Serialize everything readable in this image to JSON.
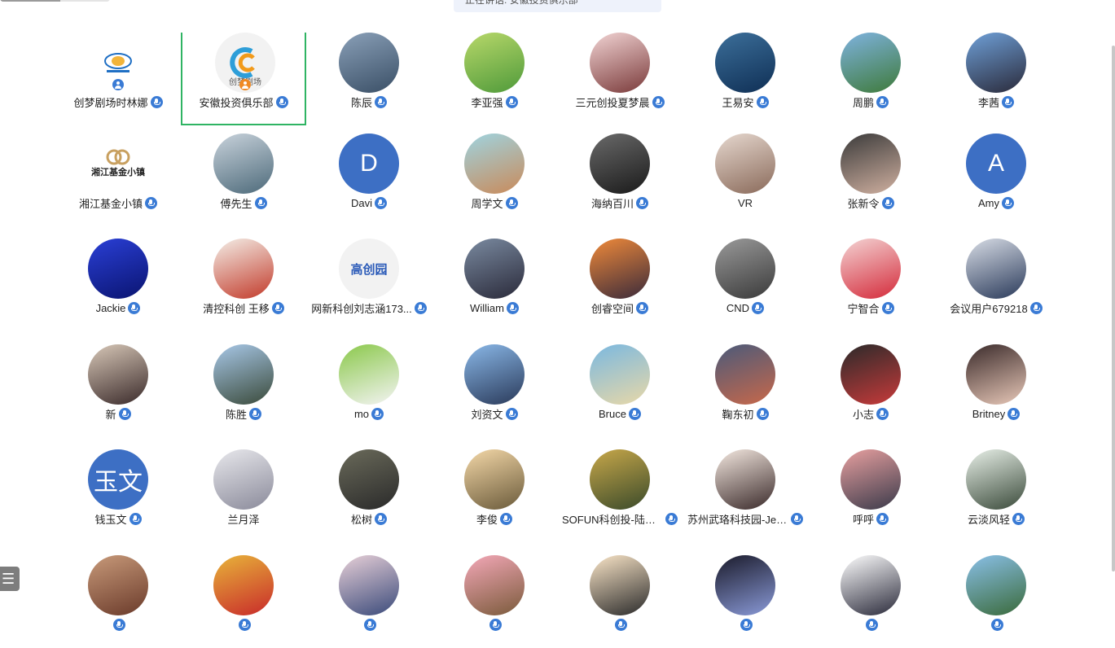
{
  "toast": {
    "text": "正在讲话: 安徽投资俱乐部"
  },
  "participants": [
    {
      "name": "创梦剧场时林娜",
      "mic": true,
      "badge": "blue",
      "avatar": "logo-blue"
    },
    {
      "name": "安徽投资俱乐部",
      "mic": true,
      "badge": "orange",
      "selected": true,
      "avatar": "logo-c",
      "logo_text": "创梦剧场"
    },
    {
      "name": "陈辰",
      "mic": true,
      "avatar": "photo",
      "colors": [
        "#8aa0b8",
        "#3a4f66"
      ]
    },
    {
      "name": "李亚强",
      "mic": true,
      "avatar": "photo",
      "colors": [
        "#b8d86a",
        "#4f9a3a"
      ]
    },
    {
      "name": "三元创投夏梦晨",
      "mic": true,
      "avatar": "photo",
      "colors": [
        "#f2d4d4",
        "#7a3a3a"
      ]
    },
    {
      "name": "王易安",
      "mic": true,
      "avatar": "photo",
      "colors": [
        "#3c6f9a",
        "#0f2f55"
      ]
    },
    {
      "name": "周鹏",
      "mic": true,
      "avatar": "photo",
      "colors": [
        "#7fb3e0",
        "#3e7a3a"
      ]
    },
    {
      "name": "李茜",
      "mic": true,
      "avatar": "photo",
      "colors": [
        "#6fa0d8",
        "#2a2a3a"
      ]
    },
    {
      "name": "湘江基金小镇",
      "mic": true,
      "avatar": "logo-xiang",
      "logo_text": "湘江基金小镇"
    },
    {
      "name": "傅先生",
      "mic": true,
      "avatar": "photo",
      "colors": [
        "#c9d3dc",
        "#4d6a7a"
      ]
    },
    {
      "name": "Davi",
      "mic": true,
      "avatar": "letter",
      "letter": "D"
    },
    {
      "name": "周学文",
      "mic": true,
      "avatar": "photo",
      "colors": [
        "#9fd4e0",
        "#c98a5a"
      ]
    },
    {
      "name": "海纳百川",
      "mic": true,
      "avatar": "photo",
      "colors": [
        "#6a6a6a",
        "#1a1a1a"
      ]
    },
    {
      "name": "VR",
      "mic": false,
      "avatar": "photo",
      "colors": [
        "#e6d8cf",
        "#8a6a5a"
      ]
    },
    {
      "name": "张新令",
      "mic": true,
      "avatar": "photo",
      "colors": [
        "#3a3a3a",
        "#d0b0a0"
      ]
    },
    {
      "name": "Amy",
      "mic": true,
      "avatar": "letter",
      "letter": "A"
    },
    {
      "name": "Jackie",
      "mic": true,
      "avatar": "photo",
      "colors": [
        "#2a3fd6",
        "#0a1470"
      ]
    },
    {
      "name": "清控科创 王移",
      "mic": true,
      "avatar": "photo",
      "colors": [
        "#f4efe8",
        "#c23a2a"
      ]
    },
    {
      "name": "网新科创刘志涵173...",
      "mic": true,
      "avatar": "logo-gao",
      "logo_text": "高创园"
    },
    {
      "name": "William",
      "mic": true,
      "avatar": "photo",
      "colors": [
        "#7a8aa0",
        "#2a2a3a"
      ]
    },
    {
      "name": "创睿空间",
      "mic": true,
      "avatar": "photo",
      "colors": [
        "#f08a3a",
        "#3a2a3a"
      ]
    },
    {
      "name": "CND",
      "mic": true,
      "avatar": "photo",
      "colors": [
        "#9a9a9a",
        "#3a3a3a"
      ]
    },
    {
      "name": "宁智合",
      "mic": true,
      "avatar": "photo",
      "colors": [
        "#f4d4d4",
        "#d42a3a"
      ]
    },
    {
      "name": "会议用户679218",
      "mic": true,
      "avatar": "photo",
      "colors": [
        "#d8dde6",
        "#2a3a5a"
      ]
    },
    {
      "name": "新",
      "mic": true,
      "avatar": "photo",
      "colors": [
        "#d8c8b8",
        "#3a2a2a"
      ]
    },
    {
      "name": "陈胜",
      "mic": true,
      "avatar": "photo",
      "colors": [
        "#a8c8e8",
        "#3a4a3a"
      ]
    },
    {
      "name": "mo",
      "mic": true,
      "avatar": "photo",
      "colors": [
        "#8ac84a",
        "#f4f4f4"
      ]
    },
    {
      "name": "刘资文",
      "mic": true,
      "avatar": "photo",
      "colors": [
        "#8ab8e8",
        "#2a3a5a"
      ]
    },
    {
      "name": "Bruce",
      "mic": true,
      "avatar": "photo",
      "colors": [
        "#7ab8e0",
        "#e8d8a8"
      ]
    },
    {
      "name": "鞠东初",
      "mic": true,
      "avatar": "photo",
      "colors": [
        "#4a5a7a",
        "#c8684a"
      ]
    },
    {
      "name": "小志",
      "mic": true,
      "avatar": "photo",
      "colors": [
        "#2a2a2a",
        "#c83a3a"
      ]
    },
    {
      "name": "Britney",
      "mic": true,
      "avatar": "photo",
      "colors": [
        "#3a2a2a",
        "#e8c8b8"
      ]
    },
    {
      "name": "钱玉文",
      "mic": true,
      "avatar": "letter",
      "letter": "玉文"
    },
    {
      "name": "兰月泽",
      "mic": false,
      "avatar": "photo",
      "colors": [
        "#e8e8ec",
        "#8a8a9a"
      ]
    },
    {
      "name": "松树",
      "mic": true,
      "avatar": "photo",
      "colors": [
        "#6a6a5a",
        "#2a2a2a"
      ]
    },
    {
      "name": "李俊",
      "mic": true,
      "avatar": "photo",
      "colors": [
        "#f4d8a8",
        "#6a5a3a"
      ]
    },
    {
      "name": "SOFUN科创投-陆沁蔚",
      "mic": true,
      "avatar": "photo",
      "colors": [
        "#c8a84a",
        "#3a4a2a"
      ]
    },
    {
      "name": "苏州武珞科技园-Jes...",
      "mic": true,
      "avatar": "photo",
      "colors": [
        "#f4e8e0",
        "#3a2a2a"
      ]
    },
    {
      "name": "呼呼",
      "mic": true,
      "avatar": "photo",
      "colors": [
        "#e8a0a0",
        "#3a3a4a"
      ]
    },
    {
      "name": "云淡风轻",
      "mic": true,
      "avatar": "photo",
      "colors": [
        "#e8f0e8",
        "#3a4a3a"
      ]
    },
    {
      "name": "",
      "mic": true,
      "avatar": "photo",
      "colors": [
        "#c89a7a",
        "#6a3a2a"
      ]
    },
    {
      "name": "",
      "mic": true,
      "avatar": "photo",
      "colors": [
        "#e8b43a",
        "#c82a2a"
      ]
    },
    {
      "name": "",
      "mic": true,
      "avatar": "photo",
      "colors": [
        "#e8d0d8",
        "#3a4a7a"
      ]
    },
    {
      "name": "",
      "mic": true,
      "avatar": "photo",
      "colors": [
        "#f4a8b8",
        "#7a5a3a"
      ]
    },
    {
      "name": "",
      "mic": true,
      "avatar": "photo",
      "colors": [
        "#fbe6c8",
        "#2a2a2a"
      ]
    },
    {
      "name": "",
      "mic": true,
      "avatar": "photo",
      "colors": [
        "#1a1a2a",
        "#8a9ad8"
      ]
    },
    {
      "name": "",
      "mic": true,
      "avatar": "photo",
      "colors": [
        "#ffffff",
        "#2a2a3a"
      ]
    },
    {
      "name": "",
      "mic": true,
      "avatar": "photo",
      "colors": [
        "#8ac0e8",
        "#3a6a3a"
      ]
    }
  ],
  "side_menu": {
    "icon": "list-icon",
    "glyph": "☰"
  }
}
